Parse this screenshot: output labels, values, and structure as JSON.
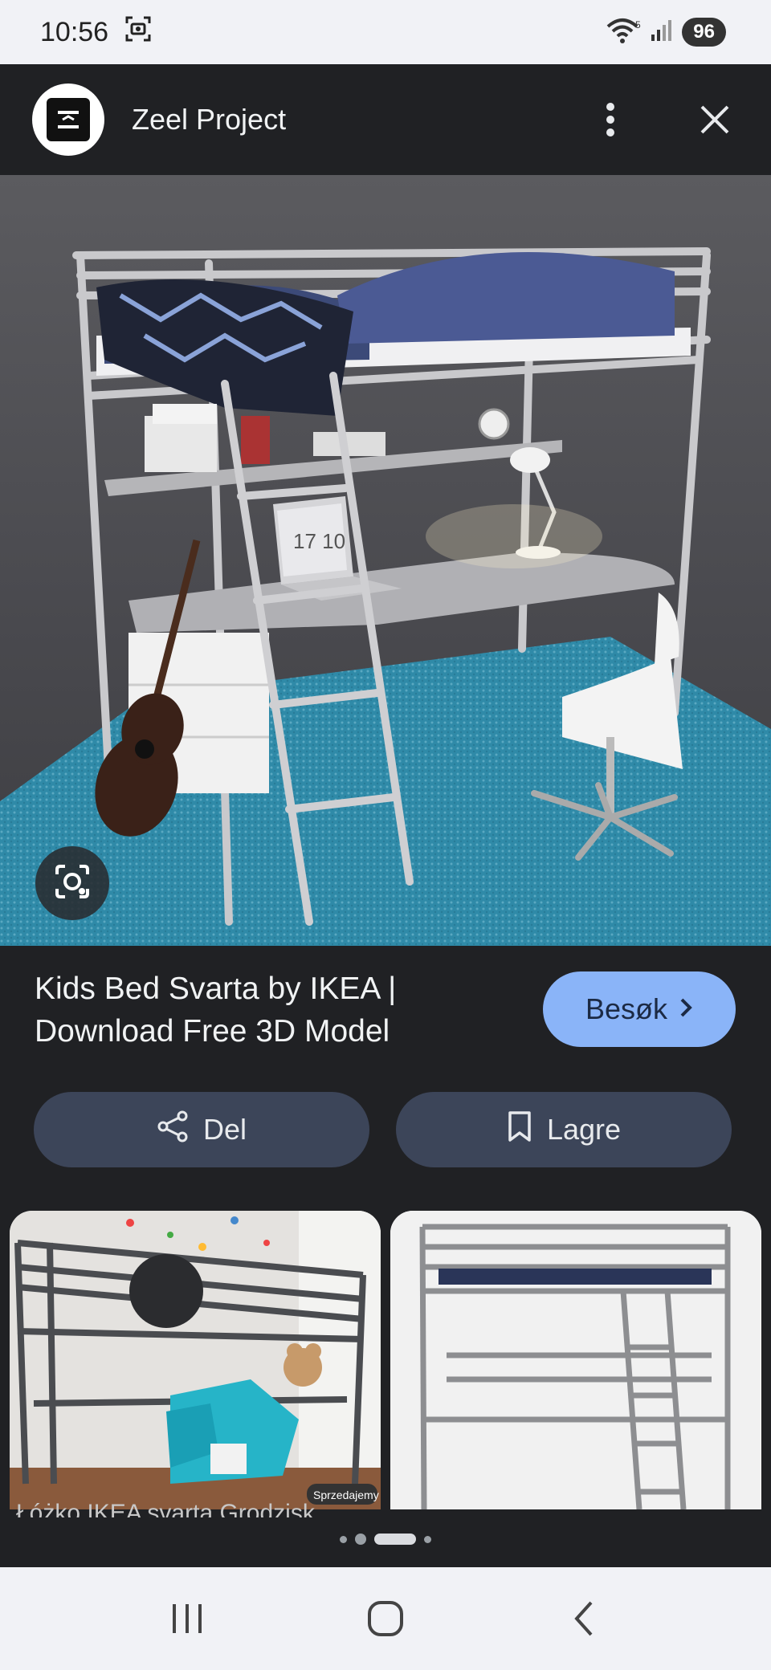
{
  "status_bar": {
    "time": "10:56",
    "battery": "96",
    "icons": [
      "screenshot-icon",
      "wifi-icon",
      "signal-icon",
      "battery-icon"
    ]
  },
  "app_bar": {
    "title": "Zeel Project",
    "icons": [
      "zeel-logo",
      "more-vert-icon",
      "close-icon"
    ]
  },
  "result": {
    "title": "Kids Bed Svarta by IKEA | Download Free 3D Model",
    "visit_label": "Besøk",
    "share_label": "Del",
    "save_label": "Lagre"
  },
  "related": {
    "items": [
      {
        "caption": "Łóżko IKEA svarta Grodzisk",
        "watermark": "Sprzedajemy"
      },
      {
        "caption": ""
      }
    ]
  },
  "carousel": {
    "page_count": 4,
    "active_index": 2
  },
  "nav_bar": {
    "icons": [
      "recents-icon",
      "home-icon",
      "back-icon"
    ]
  },
  "colors": {
    "background": "#202124",
    "accent": "#8ab4f8",
    "action_button": "#3c4559",
    "system_bars": "#f1f2f6"
  }
}
